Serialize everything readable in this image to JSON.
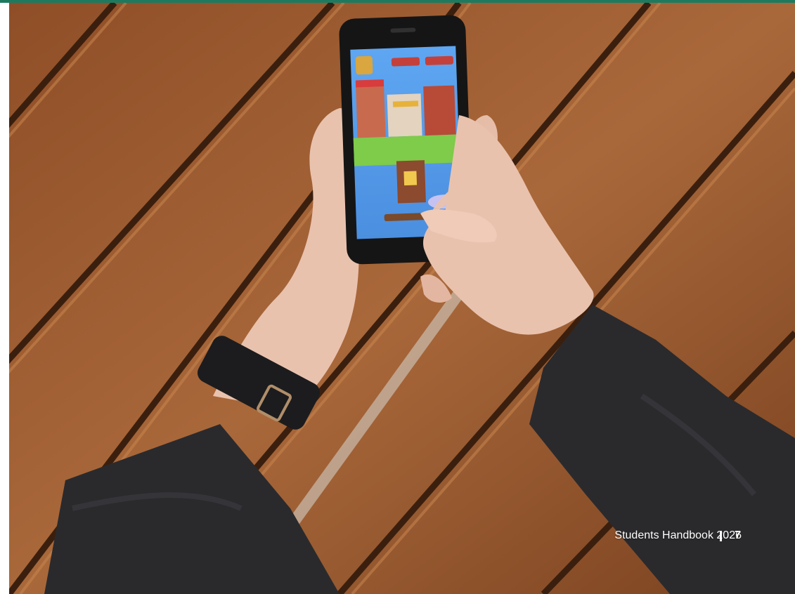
{
  "footer": {
    "handbook_title": "Students Handbook 2026",
    "page_number": "7"
  },
  "photo": {
    "subject": "phone-game-photo",
    "palette": {
      "wood": "#9a5a2e",
      "wood_dark": "#5e3419",
      "sleeve": "#2a2a2d",
      "skin": "#e9c2ae",
      "phone": "#151515",
      "screen_sky": "#5ea6f2",
      "grass": "#7fcb4a",
      "brand": "#1e7a5f"
    }
  }
}
